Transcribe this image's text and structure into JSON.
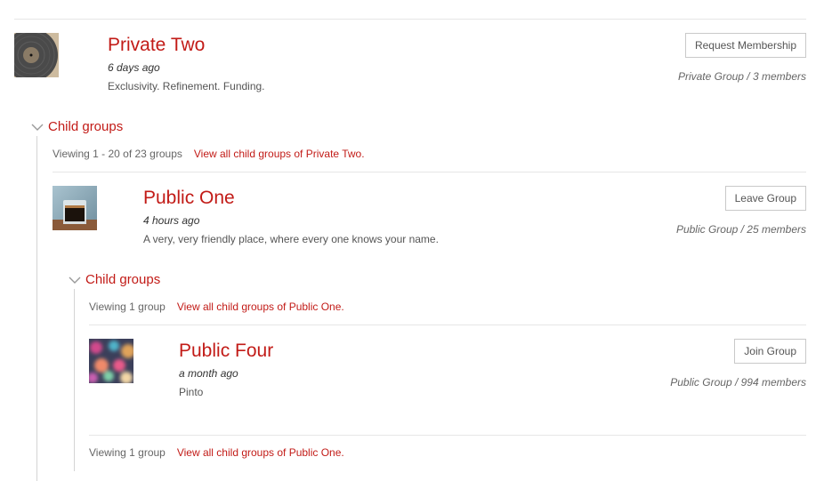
{
  "group1": {
    "name": "Private Two",
    "last_active": "6 days ago",
    "description": "Exclusivity. Refinement. Funding.",
    "action": "Request Membership",
    "type_members": "Private Group / 3 members",
    "avatar_icon": "vinyl-record-icon"
  },
  "child1": {
    "heading": "Child groups",
    "viewing": "Viewing 1 - 20 of 23 groups",
    "view_all": "View all child groups of Private Two."
  },
  "group2": {
    "name": "Public One",
    "last_active": "4 hours ago",
    "description": "A very, very friendly place, where every one knows your name.",
    "action": "Leave Group",
    "type_members": "Public Group / 25 members",
    "avatar_icon": "espresso-glass-icon"
  },
  "child2": {
    "heading": "Child groups",
    "viewing_top": "Viewing 1 group",
    "view_all_top": "View all child groups of Public One.",
    "viewing_bottom": "Viewing 1 group",
    "view_all_bottom": "View all child groups of Public One."
  },
  "group3": {
    "name": "Public Four",
    "last_active": "a month ago",
    "description": "Pinto",
    "action": "Join Group",
    "type_members": "Public Group / 994 members",
    "avatar_icon": "bokeh-lights-icon"
  },
  "colors": {
    "link": "#c21b17",
    "border": "#c9c9c9",
    "divider": "#e6e6e6"
  }
}
